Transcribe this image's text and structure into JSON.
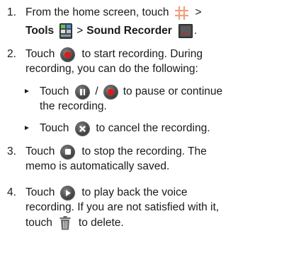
{
  "steps": [
    {
      "num": "1.",
      "l1": {
        "a": "From the home screen, touch",
        "b": ">"
      },
      "l2": {
        "tools": "Tools",
        "gt1": ">",
        "recorder": "Sound Recorder",
        "end": "."
      }
    },
    {
      "num": "2.",
      "l1": {
        "a": "Touch",
        "b": "to start recording. During"
      },
      "l2": "recording, you can do the following:",
      "sub1": {
        "a": "Touch",
        "slash": "/",
        "b": "to pause or continue",
        "cont": "the recording."
      },
      "sub2": {
        "a": "Touch",
        "b": "to cancel the recording."
      }
    },
    {
      "num": "3.",
      "l1": {
        "a": "Touch",
        "b": "to stop the recording. The"
      },
      "l2": "memo is automatically saved."
    },
    {
      "num": "4.",
      "l1": {
        "a": "Touch",
        "b": "to play back the voice"
      },
      "l2": "recording. If you are not satisfied with it,",
      "l3": {
        "a": "touch",
        "b": "to delete."
      }
    }
  ],
  "bullet_glyph": "►",
  "icons": {
    "home_grid": "grid-icon",
    "tools_folder": "tools-folder-icon",
    "sound_recorder": "sound-recorder-icon",
    "record": "record-icon",
    "pause": "pause-icon",
    "cancel": "cancel-icon",
    "stop": "stop-icon",
    "play": "play-icon",
    "delete": "trash-icon"
  },
  "colors": {
    "record_red": "#e01a1a",
    "grid_orange": "#f0a080",
    "icon_dark": "#3a3a3a"
  }
}
